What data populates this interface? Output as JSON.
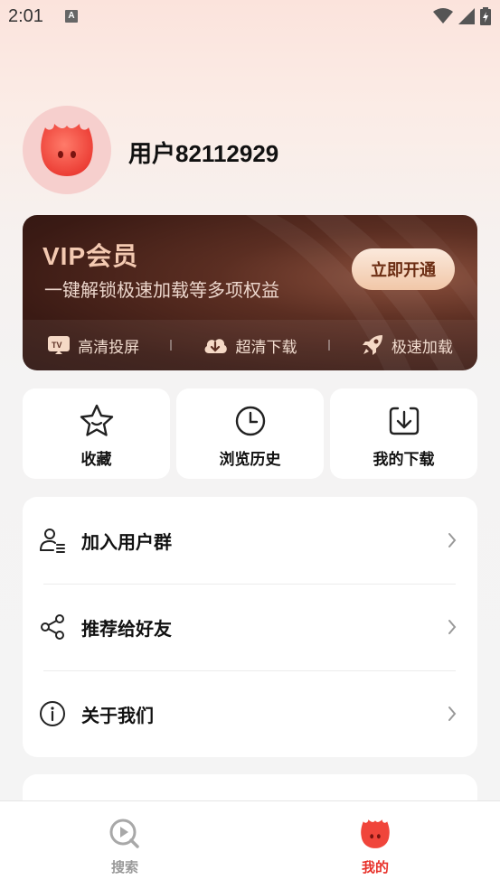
{
  "status_bar": {
    "time": "2:01",
    "notification_letter": "A"
  },
  "profile": {
    "username": "用户82112929"
  },
  "vip": {
    "title": "VIP会员",
    "subtitle": "一键解锁极速加载等多项权益",
    "button_label": "立即开通",
    "features": [
      {
        "icon": "tv-cast-icon",
        "label": "高清投屏"
      },
      {
        "icon": "cloud-download-icon",
        "label": "超清下载"
      },
      {
        "icon": "rocket-icon",
        "label": "极速加载"
      }
    ]
  },
  "quick_actions": [
    {
      "icon": "star-icon",
      "label": "收藏"
    },
    {
      "icon": "clock-icon",
      "label": "浏览历史"
    },
    {
      "icon": "download-icon",
      "label": "我的下载"
    }
  ],
  "menu": [
    {
      "icon": "user-group-icon",
      "label": "加入用户群"
    },
    {
      "icon": "share-icon",
      "label": "推荐给好友"
    },
    {
      "icon": "info-icon",
      "label": "关于我们"
    }
  ],
  "bottom_nav": [
    {
      "icon": "search-play-icon",
      "label": "搜索",
      "active": false
    },
    {
      "icon": "flame-mascot-icon",
      "label": "我的",
      "active": true
    }
  ],
  "colors": {
    "active_nav": "#e8322b",
    "inactive_nav": "#999999",
    "vip_gold": "#f3c9b1",
    "mascot_red": "#f0453b"
  }
}
